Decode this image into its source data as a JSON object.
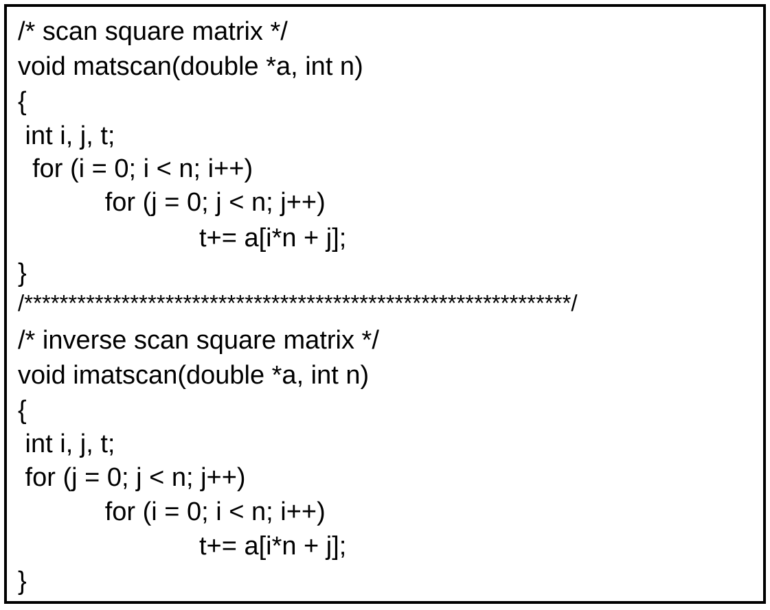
{
  "code_block": {
    "lines": [
      "/* scan square matrix */",
      "void matscan(double *a, int n)",
      "{",
      " int i, j, t;",
      "  for (i = 0; i < n; i++)",
      "            for (j = 0; j < n; j++)",
      "                         t+= a[i*n + j];",
      "}",
      "/**************************************************************/",
      "/* inverse scan square matrix */",
      "void imatscan(double *a, int n)",
      "{",
      " int i, j, t;",
      " for (j = 0; j < n; j++)",
      "            for (i = 0; i < n; i++)",
      "                         t+= a[i*n + j];",
      "}"
    ]
  }
}
